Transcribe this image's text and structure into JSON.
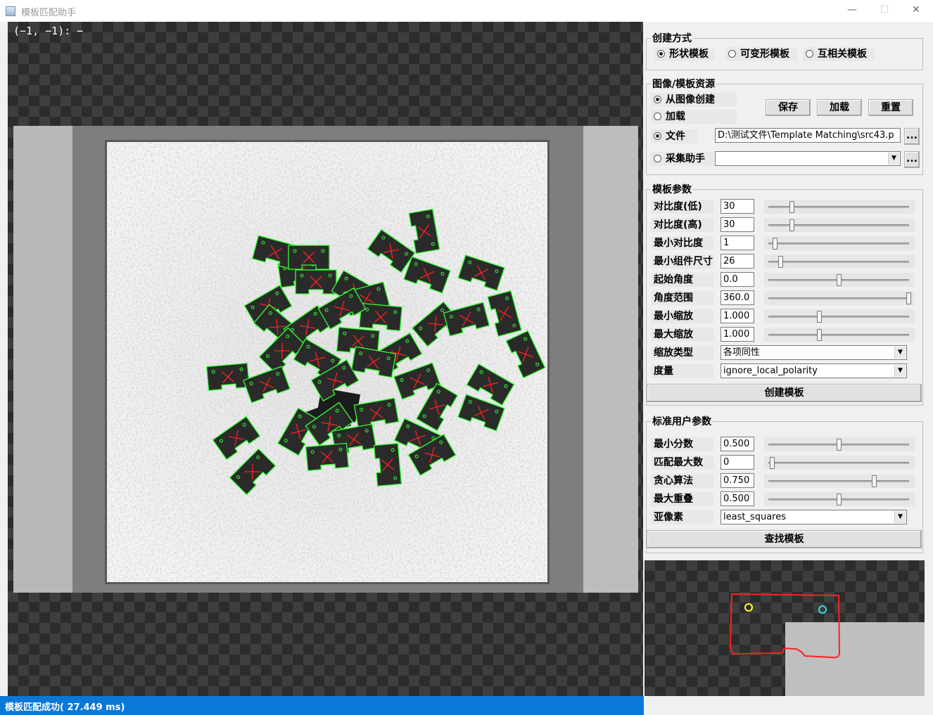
{
  "window": {
    "title": "模板匹配助手",
    "minimize": "—",
    "maximize": "☐",
    "close": "✕"
  },
  "viewer": {
    "coord_readout": "(−1, −1): −"
  },
  "status": {
    "text": "模板匹配成功( 27.449 ms)"
  },
  "create_method": {
    "title": "创建方式",
    "options": [
      {
        "label": "形状模板",
        "selected": true
      },
      {
        "label": "可变形模板",
        "selected": false
      },
      {
        "label": "互相关模板",
        "selected": false
      }
    ]
  },
  "source": {
    "title": "图像/模板资源",
    "from_image": "从图像创建",
    "load": "加载",
    "file": "文件",
    "file_path": "D:\\测试文件\\Template Matching\\src43.p",
    "capture": "采集助手",
    "capture_value": "",
    "browse": "...",
    "buttons": {
      "save": "保存",
      "load": "加载",
      "reset": "重置"
    }
  },
  "template_params": {
    "title": "模板参数",
    "rows": [
      {
        "label": "对比度(低)",
        "value": "30",
        "level": 0.16
      },
      {
        "label": "对比度(高)",
        "value": "30",
        "level": 0.16
      },
      {
        "label": "最小对比度",
        "value": "1",
        "level": 0.04
      },
      {
        "label": "最小组件尺寸",
        "value": "26",
        "level": 0.08
      },
      {
        "label": "起始角度",
        "value": "0.0",
        "level": 0.5
      },
      {
        "label": "角度范围",
        "value": "360.0",
        "level": 1.0
      },
      {
        "label": "最小缩放",
        "value": "1.000",
        "level": 0.36
      },
      {
        "label": "最大缩放",
        "value": "1.000",
        "level": 0.36
      }
    ],
    "scale_type_label": "缩放类型",
    "scale_type_value": "各项同性",
    "metric_label": "度量",
    "metric_value": "ignore_local_polarity",
    "create_button": "创建模板"
  },
  "user_params": {
    "title": "标准用户参数",
    "rows": [
      {
        "label": "最小分数",
        "value": "0.500",
        "level": 0.5
      },
      {
        "label": "匹配最大数",
        "value": "0",
        "level": 0.02
      },
      {
        "label": "贪心算法",
        "value": "0.750",
        "level": 0.75
      },
      {
        "label": "最大重叠",
        "value": "0.500",
        "level": 0.5
      }
    ],
    "subpixel_label": "亚像素",
    "subpixel_value": "least_squares",
    "find_button": "查找模板"
  },
  "colors": {
    "status_bar": "#0a78d7",
    "match_outline": "#33ff33",
    "match_cross": "#ff2020",
    "preview_outline": "#ff2020"
  }
}
